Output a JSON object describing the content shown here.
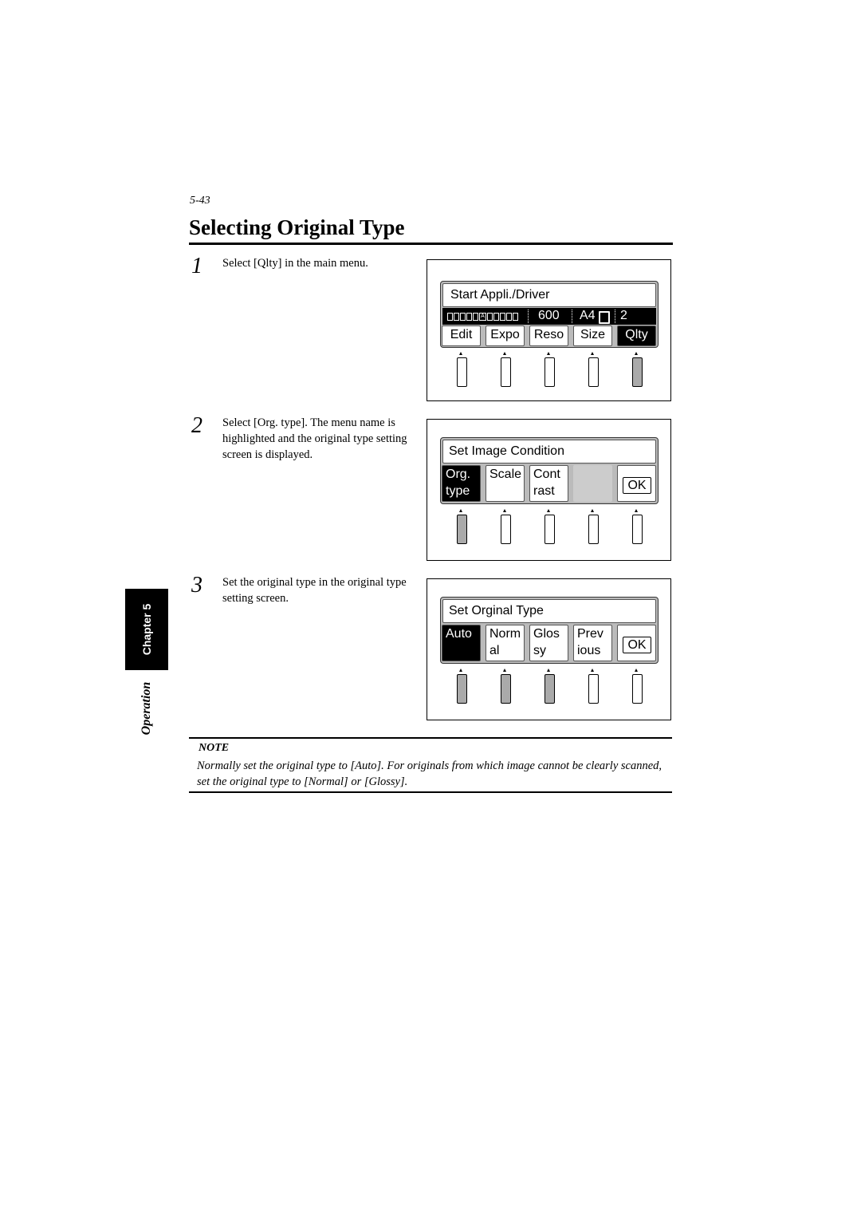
{
  "page_number": "5-43",
  "title": "Selecting Original Type",
  "steps": [
    {
      "num": "1",
      "text": "Select [Qlty] in the main menu."
    },
    {
      "num": "2",
      "text": "Select [Org. type]. The menu name is highlighted and the original type setting screen is displayed."
    },
    {
      "num": "3",
      "text": "Set the original type in the original type setting screen."
    }
  ],
  "screen1": {
    "title": "Start Appli./Driver",
    "status": {
      "resolution": "600",
      "size": "A4",
      "copies": "2",
      "exposure_marker": "A"
    },
    "buttons": [
      "Edit",
      "Expo",
      "Reso",
      "Size",
      "Qlty"
    ],
    "selected": "Qlty"
  },
  "screen2": {
    "title": "Set Image Condition",
    "buttons": [
      [
        "Org.",
        "type"
      ],
      [
        "Scale",
        ""
      ],
      [
        "Cont",
        "rast"
      ]
    ],
    "ok": "OK",
    "selected": "Org. type"
  },
  "screen3": {
    "title": "Set Orginal Type",
    "buttons": [
      [
        "Auto",
        ""
      ],
      [
        "Norm",
        "al"
      ],
      [
        "Glos",
        "sy"
      ],
      [
        "Prev",
        "ious"
      ]
    ],
    "ok": "OK",
    "selected": "Auto"
  },
  "side_tab": {
    "chapter": "Chapter 5",
    "section": "Operation"
  },
  "note": {
    "heading": "NOTE",
    "text": "Normally set the original type to [Auto]. For originals from which image cannot be clearly scanned, set the original type to [Normal] or [Glossy]."
  }
}
